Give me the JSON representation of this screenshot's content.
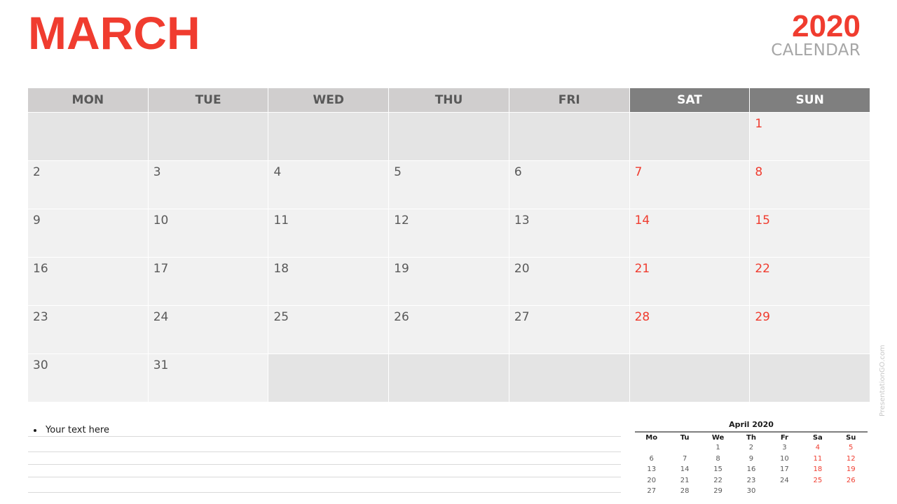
{
  "header": {
    "month": "MARCH",
    "year": "2020",
    "subtitle": "CALENDAR"
  },
  "colors": {
    "accent": "#f03c2f",
    "header_bg": "#d0cece",
    "weekend_header_bg": "#7f7f7f",
    "cell_bg": "#f1f1f1",
    "empty_cell_bg": "#e4e4e4",
    "text": "#595959"
  },
  "calendar": {
    "weekdays": [
      {
        "label": "MON",
        "weekend": false
      },
      {
        "label": "TUE",
        "weekend": false
      },
      {
        "label": "WED",
        "weekend": false
      },
      {
        "label": "THU",
        "weekend": false
      },
      {
        "label": "FRI",
        "weekend": false
      },
      {
        "label": "SAT",
        "weekend": true
      },
      {
        "label": "SUN",
        "weekend": true
      }
    ],
    "weeks": [
      [
        "",
        "",
        "",
        "",
        "",
        "",
        "1"
      ],
      [
        "2",
        "3",
        "4",
        "5",
        "6",
        "7",
        "8"
      ],
      [
        "9",
        "10",
        "11",
        "12",
        "13",
        "14",
        "15"
      ],
      [
        "16",
        "17",
        "18",
        "19",
        "20",
        "21",
        "22"
      ],
      [
        "23",
        "24",
        "25",
        "26",
        "27",
        "28",
        "29"
      ],
      [
        "30",
        "31",
        "",
        "",
        "",
        "",
        ""
      ]
    ]
  },
  "notes": {
    "items": [
      "Your text here"
    ]
  },
  "mini_calendar": {
    "title": "April 2020",
    "weekdays": [
      "Mo",
      "Tu",
      "We",
      "Th",
      "Fr",
      "Sa",
      "Su"
    ],
    "weeks": [
      [
        "",
        "",
        "1",
        "2",
        "3",
        "4",
        "5"
      ],
      [
        "6",
        "7",
        "8",
        "9",
        "10",
        "11",
        "12"
      ],
      [
        "13",
        "14",
        "15",
        "16",
        "17",
        "18",
        "19"
      ],
      [
        "20",
        "21",
        "22",
        "23",
        "24",
        "25",
        "26"
      ],
      [
        "27",
        "28",
        "29",
        "30",
        "",
        "",
        ""
      ]
    ]
  },
  "watermark": "PresentationGO.com"
}
